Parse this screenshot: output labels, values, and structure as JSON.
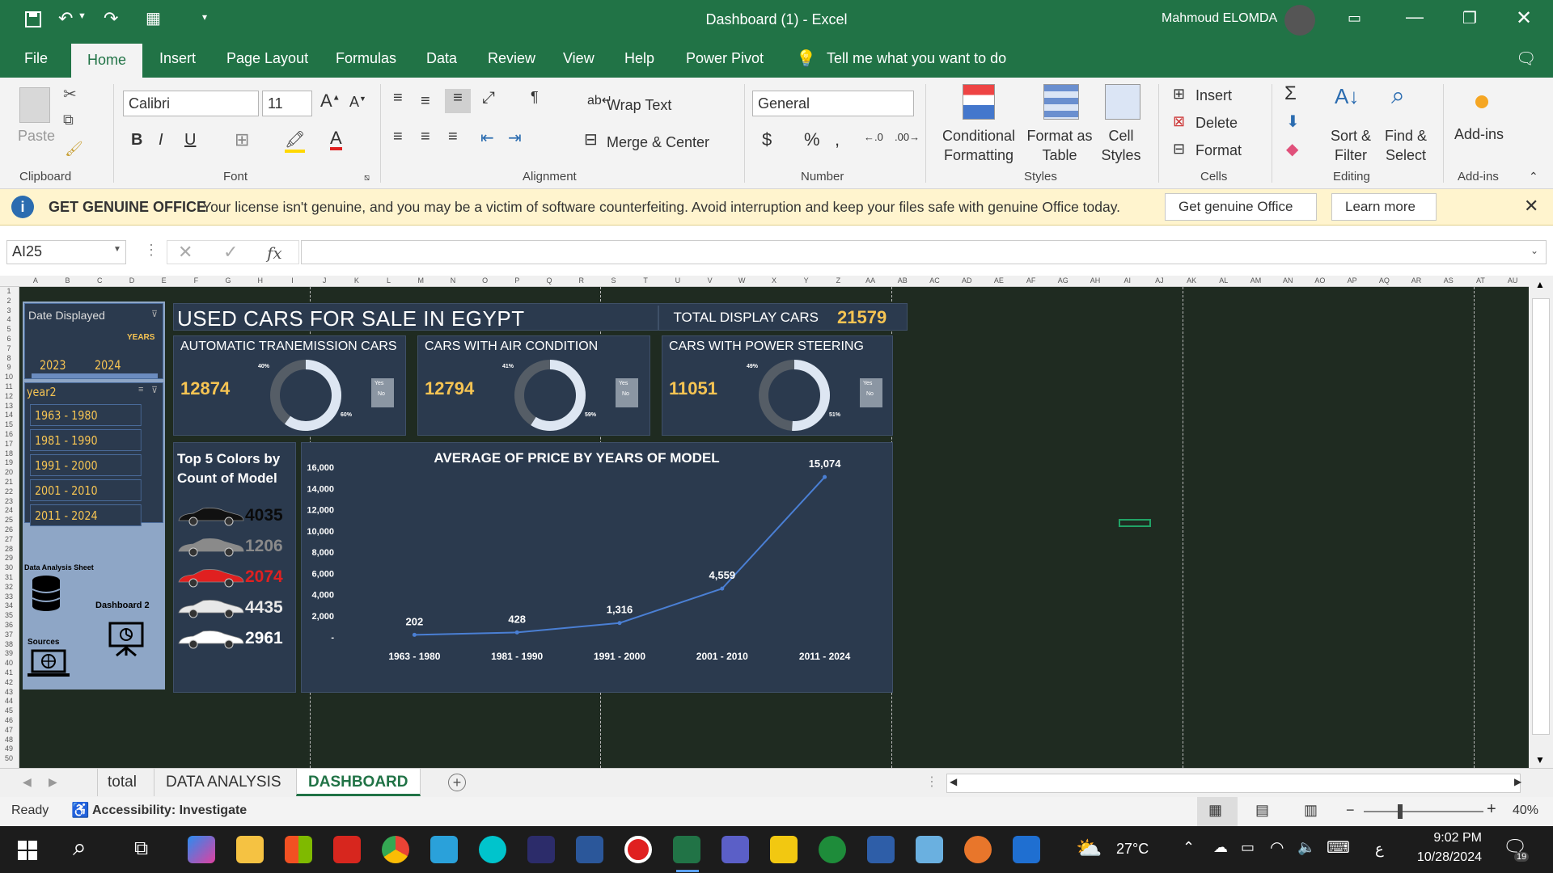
{
  "window": {
    "title": "Dashboard (1)  -  Excel",
    "user": "Mahmoud ELOMDA"
  },
  "menu": {
    "tabs": [
      "File",
      "Home",
      "Insert",
      "Page Layout",
      "Formulas",
      "Data",
      "Review",
      "View",
      "Help",
      "Power Pivot"
    ],
    "tell_me": "Tell me what you want to do"
  },
  "ribbon": {
    "clipboard": {
      "paste": "Paste",
      "label": "Clipboard"
    },
    "font": {
      "name": "Calibri",
      "size": "11",
      "label": "Font"
    },
    "alignment": {
      "wrap": "Wrap Text",
      "merge": "Merge & Center",
      "label": "Alignment"
    },
    "number": {
      "format": "General",
      "label": "Number"
    },
    "styles": {
      "cond1": "Conditional",
      "cond2": "Formatting",
      "fmt1": "Format as",
      "fmt2": "Table",
      "cell1": "Cell",
      "cell2": "Styles",
      "label": "Styles"
    },
    "cells": {
      "insert": "Insert",
      "delete": "Delete",
      "format": "Format",
      "label": "Cells"
    },
    "editing": {
      "sort1": "Sort &",
      "sort2": "Filter",
      "find1": "Find &",
      "find2": "Select",
      "label": "Editing"
    },
    "addins": {
      "btn": "Add-ins",
      "label": "Add-ins"
    }
  },
  "infobar": {
    "title": "GET GENUINE OFFICE",
    "message": "Your license isn't genuine, and you may be a victim of software counterfeiting. Avoid interruption and keep your files safe with genuine Office today.",
    "btn1": "Get genuine Office",
    "btn2": "Learn more"
  },
  "formula": {
    "namebox": "AI25",
    "fx": "fx",
    "value": ""
  },
  "columns": [
    "A",
    "B",
    "C",
    "D",
    "E",
    "F",
    "G",
    "H",
    "I",
    "J",
    "K",
    "L",
    "M",
    "N",
    "O",
    "P",
    "Q",
    "R",
    "S",
    "T",
    "U",
    "V",
    "W",
    "X",
    "Y",
    "Z",
    "AA",
    "AB",
    "AC",
    "AD",
    "AE",
    "AF",
    "AG",
    "AH",
    "AI",
    "AJ",
    "AK",
    "AL",
    "AM",
    "AN",
    "AO",
    "AP",
    "AQ",
    "AR",
    "AS",
    "AT",
    "AU"
  ],
  "dashboard": {
    "date_slicer": {
      "title": "Date Displayed",
      "unit": "YEARS",
      "years": [
        "2023",
        "2024"
      ]
    },
    "year_slicer": {
      "title": "year2",
      "items": [
        "1963 - 1980",
        "1981 - 1990",
        "1991 - 2000",
        "2001 - 2010",
        "2011 - 2024"
      ]
    },
    "nav": {
      "data_analysis": "Data Analysis Sheet",
      "dashboard2": "Dashboard 2",
      "sources": "Sources"
    },
    "title": "USED CARS FOR SALE IN EGYPT",
    "total_label": "TOTAL DISPLAY CARS",
    "total_value": "21579",
    "kpis": [
      {
        "title": "AUTOMATIC TRANEMISSION CARS",
        "value": "12874",
        "pct_a": "40%",
        "pct_b": "60%",
        "legend_yes": "Yes",
        "legend_no": "No",
        "share": 0.6
      },
      {
        "title": "CARS WITH  AIR CONDITION",
        "value": "12794",
        "pct_a": "41%",
        "pct_b": "59%",
        "legend_yes": "Yes",
        "legend_no": "No",
        "share": 0.59
      },
      {
        "title": "CARS WITH POWER STEERING",
        "value": "11051",
        "pct_a": "49%",
        "pct_b": "51%",
        "legend_yes": "Yes",
        "legend_no": "No",
        "share": 0.51
      }
    ],
    "colors": {
      "title1": "Top 5 Colors by",
      "title2": "Count of Model",
      "items": [
        {
          "value": "4035",
          "color": "#111111"
        },
        {
          "value": "1206",
          "color": "#8a8a8a"
        },
        {
          "value": "2074",
          "color": "#e02020"
        },
        {
          "value": "4435",
          "color": "#e8e8e8"
        },
        {
          "value": "2961",
          "color": "#ffffff"
        }
      ]
    }
  },
  "chart_data": {
    "type": "line",
    "title": "AVERAGE OF PRICE BY YEARS OF MODEL",
    "categories": [
      "1963 - 1980",
      "1981 - 1990",
      "1991 - 2000",
      "2001 - 2010",
      "2011 - 2024"
    ],
    "values": [
      202,
      428,
      1316,
      4559,
      15074
    ],
    "data_labels": [
      "202",
      "428",
      "1,316",
      "4,559",
      "15,074"
    ],
    "ylim": [
      0,
      16000
    ],
    "yticks": [
      "16,000",
      "14,000",
      "12,000",
      "10,000",
      "8,000",
      "6,000",
      "4,000",
      "2,000",
      "-"
    ],
    "color": "#4a7fd4"
  },
  "sheets": {
    "tabs": [
      "total",
      "DATA ANALYSIS",
      "DASHBOARD"
    ],
    "active": "DASHBOARD"
  },
  "status": {
    "ready": "Ready",
    "accessibility": "Accessibility: Investigate",
    "zoom": "40%"
  },
  "taskbar": {
    "weather": "27°C",
    "time": "9:02 PM",
    "date": "10/28/2024",
    "lang": "ع",
    "notif": "19"
  }
}
